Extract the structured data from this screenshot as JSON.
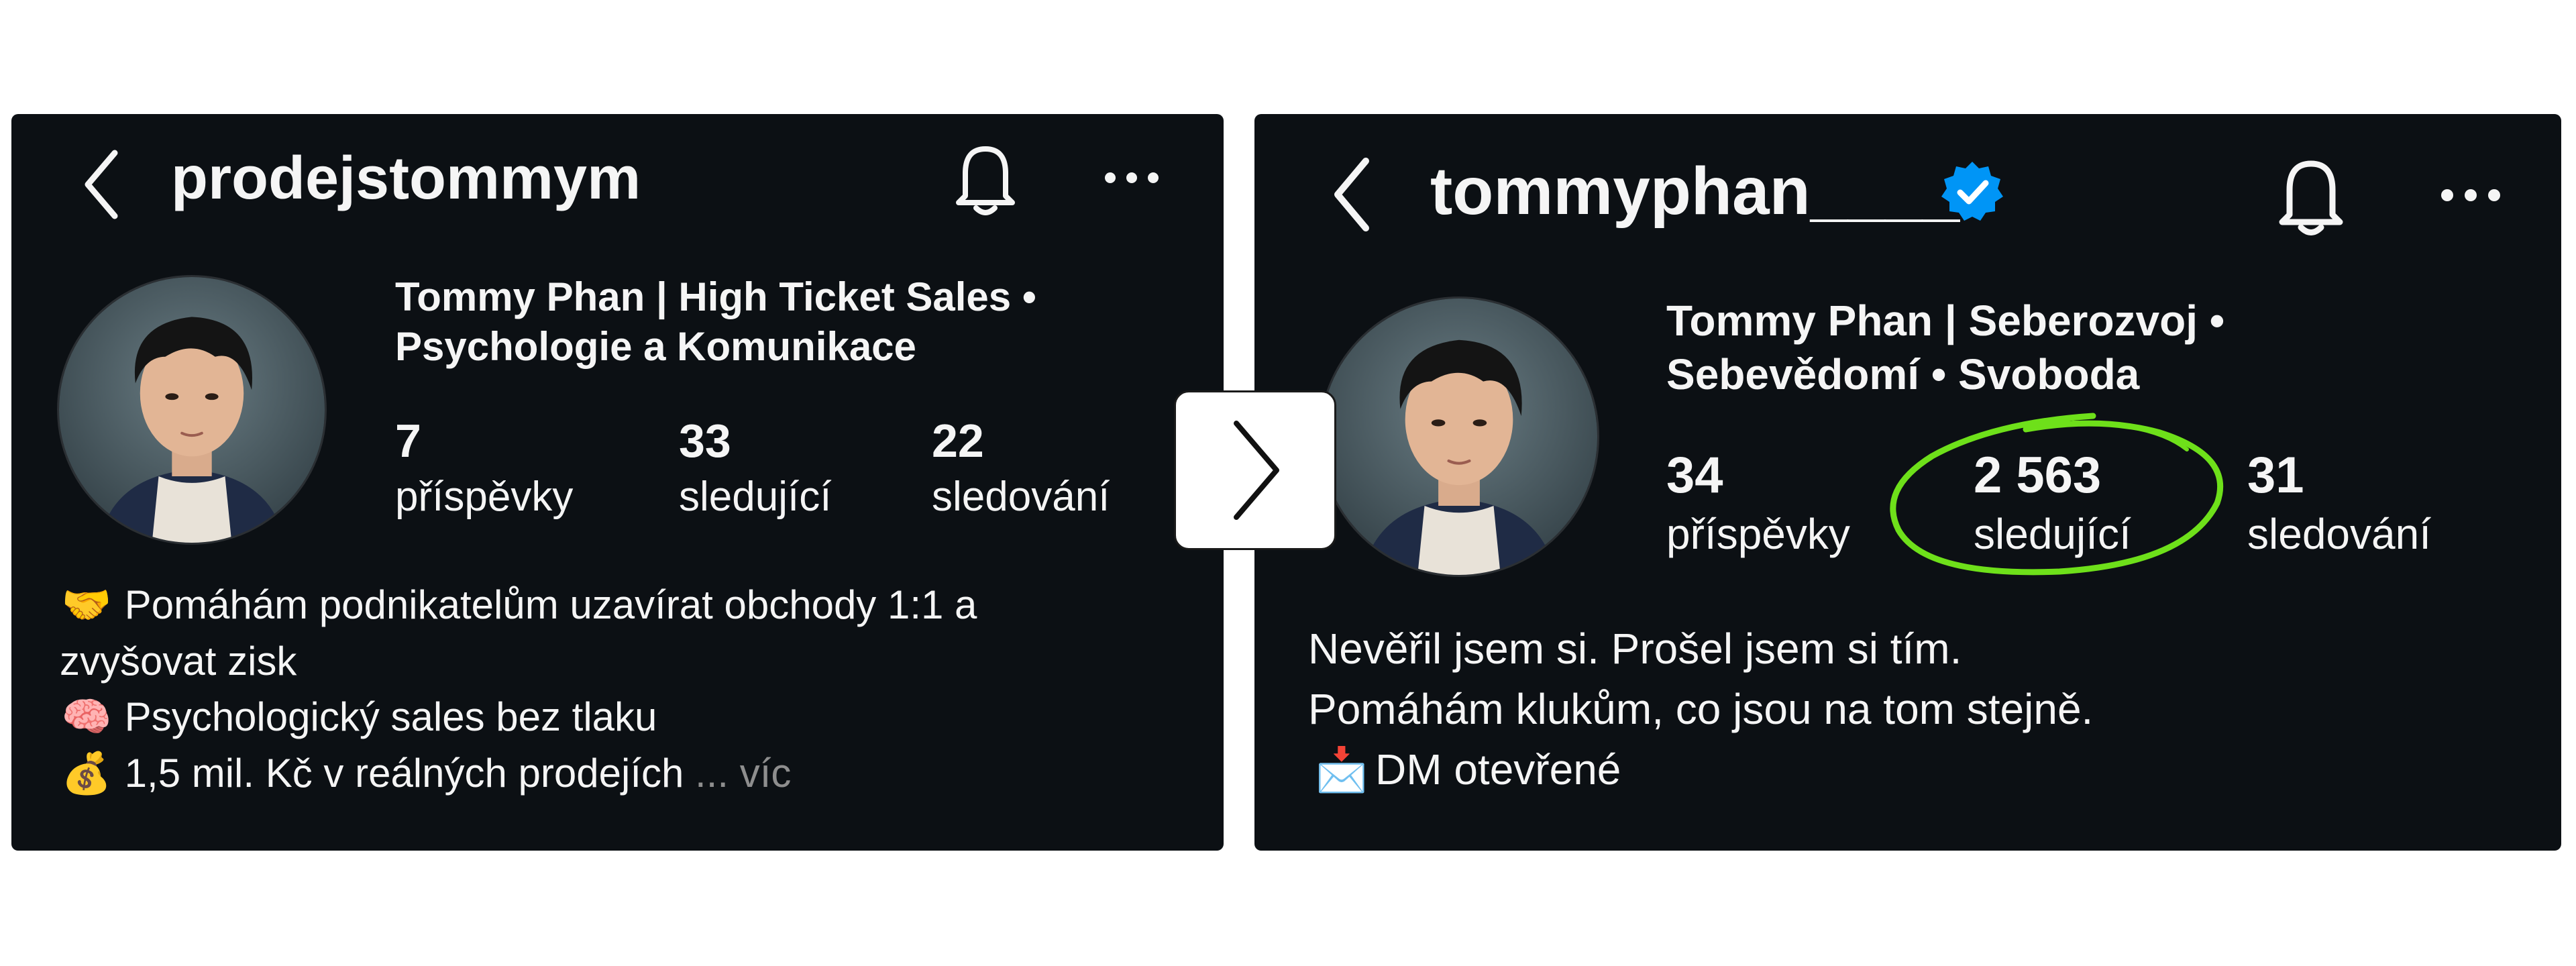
{
  "left_profile": {
    "username": "prodejstommym",
    "display_name_line1": "Tommy Phan | High Ticket Sales •",
    "display_name_line2": "Psychologie a Komunikace",
    "stats": [
      {
        "value": "7",
        "label": "příspěvky"
      },
      {
        "value": "33",
        "label": "sledující"
      },
      {
        "value": "22",
        "label": "sledování"
      }
    ],
    "bio": {
      "line1_emoji": "🤝",
      "line1": "Pomáhám podnikatelům uzavírat obchody 1:1 a",
      "line2": "zvyšovat zisk",
      "line3_emoji": "🧠",
      "line3": "Psychologický sales bez tlaku",
      "line4_emoji": "💰",
      "line4": "1,5 mil. Kč v reálných prodejích",
      "more_label": "... víc"
    }
  },
  "right_profile": {
    "username": "tommyphan____",
    "verified": true,
    "display_name_line1": "Tommy Phan | Seberozvoj •",
    "display_name_line2": "Sebevědomí • Svoboda",
    "stats": [
      {
        "value": "34",
        "label": "příspěvky"
      },
      {
        "value": "2 563",
        "label": "sledující"
      },
      {
        "value": "31",
        "label": "sledování"
      }
    ],
    "bio": {
      "line1": "Nevěřil jsem si. Prošel jsem si tím.",
      "line2": "Pomáhám klukům, co jsou na tom stejně.",
      "line3_emoji": "📩",
      "line3": "DM otevřené"
    }
  },
  "icons": {
    "back": "chevron-left-icon",
    "notifications": "bell-icon",
    "more": "more-horizontal-icon",
    "verified": "verified-badge-icon",
    "next": "chevron-right-icon"
  },
  "colors": {
    "panel_bg": "#0c1014",
    "text": "#f5f5f5",
    "muted": "#8e8e8e",
    "verified_blue": "#0095f6",
    "highlight_green": "#6ee01a"
  }
}
